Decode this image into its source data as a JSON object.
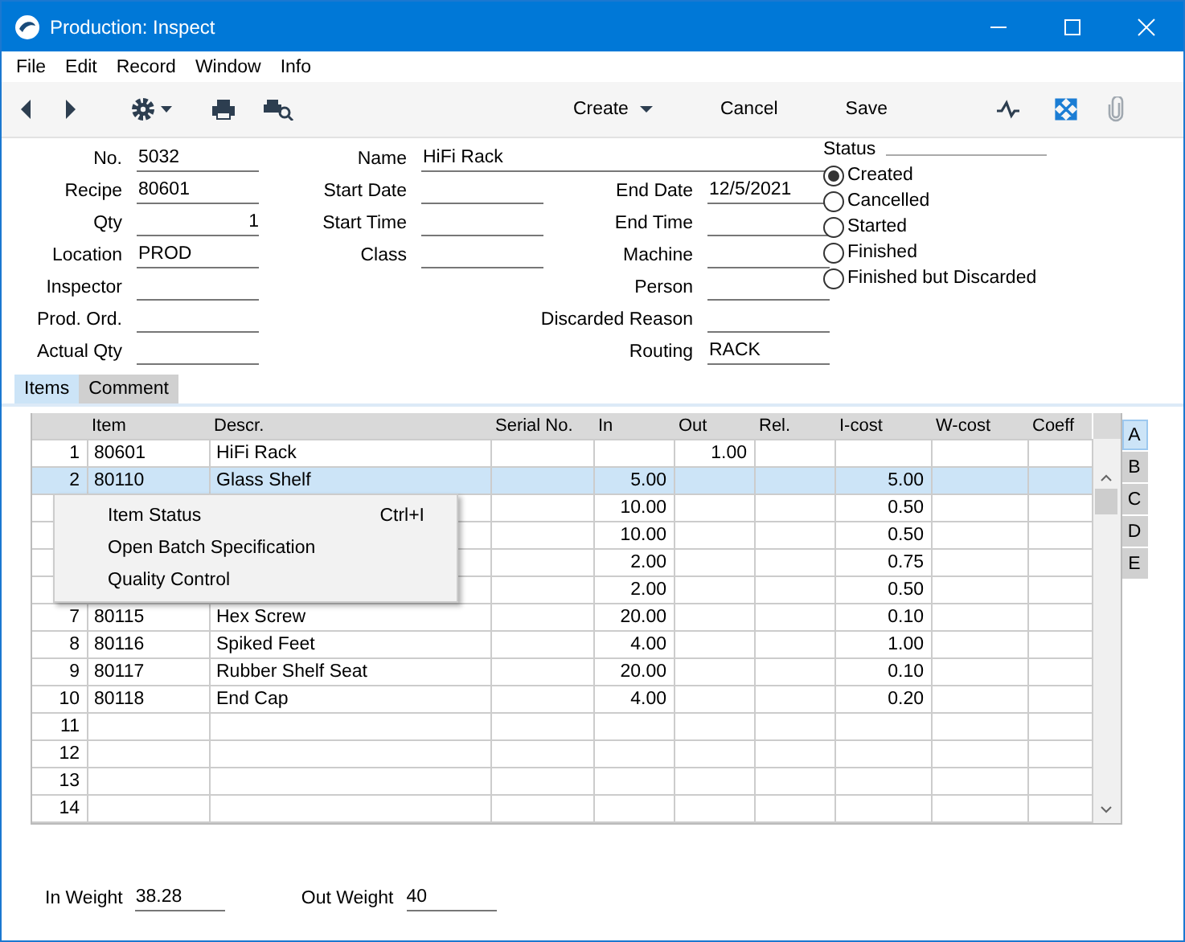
{
  "window": {
    "title": "Production: Inspect"
  },
  "menu": [
    "File",
    "Edit",
    "Record",
    "Window",
    "Info"
  ],
  "toolbar": {
    "buttons": [
      {
        "label": "Create",
        "dropdown": true
      },
      {
        "label": "Cancel",
        "dropdown": false
      },
      {
        "label": "Save",
        "dropdown": false
      }
    ]
  },
  "form": {
    "columns": [
      [
        {
          "label": "No.",
          "value": "5032",
          "kind": "text"
        },
        {
          "label": "Recipe",
          "value": "80601",
          "kind": "text"
        },
        {
          "label": "Qty",
          "value": "1",
          "kind": "number"
        },
        {
          "label": "Location",
          "value": "PROD",
          "kind": "text"
        },
        {
          "label": "Inspector",
          "kind": "text"
        },
        {
          "label": "Prod. Ord.",
          "kind": "text"
        },
        {
          "label": "Actual Qty",
          "kind": "text"
        }
      ],
      [
        {
          "label": "Name",
          "value": "HiFi Rack",
          "kind": "text"
        },
        {
          "label": "Start Date",
          "kind": "text"
        },
        {
          "label": "Start Time",
          "kind": "text"
        },
        {
          "label": "Class",
          "kind": "text"
        }
      ],
      [
        {
          "label": "End Date",
          "value": "12/5/2021",
          "kind": "text"
        },
        {
          "label": "End Time",
          "kind": "text"
        },
        {
          "label": "Machine",
          "kind": "text"
        },
        {
          "label": "Person",
          "kind": "text"
        },
        {
          "label": "Discarded Reason",
          "kind": "text"
        },
        {
          "label": "Routing",
          "value": "RACK",
          "kind": "text"
        }
      ]
    ]
  },
  "status": {
    "label": "Status",
    "options": [
      {
        "label": "Created",
        "selected": true
      },
      {
        "label": "Cancelled",
        "selected": false
      },
      {
        "label": "Started",
        "selected": false
      },
      {
        "label": "Finished",
        "selected": false
      },
      {
        "label": "Finished but Discarded",
        "selected": false
      }
    ]
  },
  "tabs": [
    {
      "label": "Items",
      "selected": true
    },
    {
      "label": "Comment",
      "selected": false
    }
  ],
  "table": {
    "columns": [
      "Item",
      "Descr.",
      "Serial No.",
      "In",
      "Out",
      "Rel.",
      "I-cost",
      "W-cost",
      "Coeff"
    ],
    "rows": [
      {
        "no": "1",
        "item": "80601",
        "descr": "HiFi Rack",
        "out": "1.00",
        "selected": false
      },
      {
        "no": "2",
        "item": "80110",
        "descr": "Glass Shelf",
        "in": "5.00",
        "i_cost": "5.00",
        "selected": true
      },
      {
        "in": "10.00",
        "i_cost": "0.50",
        "selected": false
      },
      {
        "in": "10.00",
        "i_cost": "0.50",
        "selected": false
      },
      {
        "in": "2.00",
        "i_cost": "0.75",
        "selected": false
      },
      {
        "in": "2.00",
        "i_cost": "0.50",
        "selected": false
      },
      {
        "no": "7",
        "item": "80115",
        "descr": "Hex Screw",
        "in": "20.00",
        "i_cost": "0.10",
        "selected": false
      },
      {
        "no": "8",
        "item": "80116",
        "descr": "Spiked Feet",
        "in": "4.00",
        "i_cost": "1.00",
        "selected": false
      },
      {
        "no": "9",
        "item": "80117",
        "descr": "Rubber Shelf Seat",
        "in": "20.00",
        "i_cost": "0.10",
        "selected": false
      },
      {
        "no": "10",
        "item": "80118",
        "descr": "End Cap",
        "in": "4.00",
        "i_cost": "0.20",
        "selected": false
      },
      {
        "no": "11",
        "selected": false
      },
      {
        "no": "12",
        "selected": false
      },
      {
        "no": "13",
        "selected": false
      },
      {
        "no": "14",
        "selected": false
      }
    ]
  },
  "side_tabs": [
    {
      "label": "A",
      "selected": true
    },
    {
      "label": "B",
      "selected": false
    },
    {
      "label": "C",
      "selected": false
    },
    {
      "label": "D",
      "selected": false
    },
    {
      "label": "E",
      "selected": false
    }
  ],
  "context_menu": [
    {
      "label": "Item Status",
      "shortcut": "Ctrl+I"
    },
    {
      "label": "Open Batch Specification"
    },
    {
      "label": "Quality Control"
    }
  ],
  "footer": [
    {
      "label": "In Weight",
      "value": "38.28"
    },
    {
      "label": "Out Weight",
      "value": "40"
    }
  ]
}
